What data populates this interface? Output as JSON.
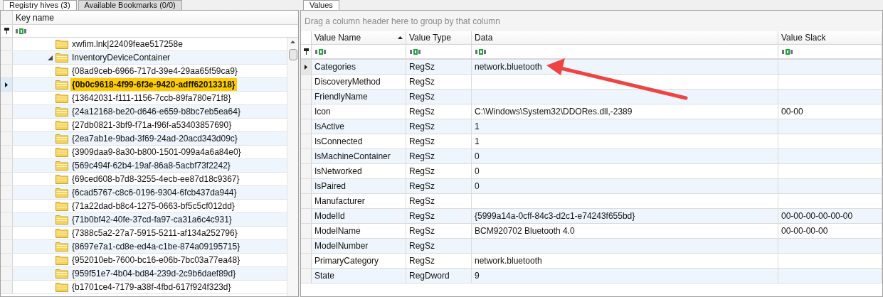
{
  "left_tabs": [
    {
      "label": "Registry hives (3)",
      "selected": true
    },
    {
      "label": "Available Bookmarks (0/0)",
      "selected": false
    }
  ],
  "tree": {
    "column": "Key name",
    "items": [
      {
        "children": [
          {
            "label": "xwfim.lnk|22409feae517258e",
            "selected": false
          }
        ]
      },
      {
        "label": "InventoryDeviceContainer",
        "expanded": true,
        "selected": false,
        "children": [
          {
            "label": "{08ad9ceb-6966-717d-39e4-29aa65f59ca9}",
            "selected": false
          },
          {
            "label": "{0b0c9618-4f99-6f3e-9420-adff62013318}",
            "selected": true
          },
          {
            "label": "{13642031-f111-1156-7ccb-89fa780e71f8}",
            "selected": false
          },
          {
            "label": "{24a12168-be20-d646-e659-b8bc7eb5ea64}",
            "selected": false
          },
          {
            "label": "{27db0821-3bf9-f71a-f96f-a53403857690}",
            "selected": false
          },
          {
            "label": "{2ea7ab1e-9bad-3f69-24ad-20acd343d09c}",
            "selected": false
          },
          {
            "label": "{3909daa9-8a30-b800-1501-099a4a6a84e0}",
            "selected": false
          },
          {
            "label": "{569c494f-62b4-19af-86a8-5acbf73f2242}",
            "selected": false
          },
          {
            "label": "{69ced608-b7d8-3255-4ecb-ee87d18c9367}",
            "selected": false
          },
          {
            "label": "{6cad5767-c8c6-0196-9304-6fcb437da944}",
            "selected": false
          },
          {
            "label": "{71a22dad-b8c4-1275-0663-bf5c5cf012dd}",
            "selected": false
          },
          {
            "label": "{71b0bf42-40fe-37cd-fa97-ca31a6c4c931}",
            "selected": false
          },
          {
            "label": "{7388c5a2-27a7-5915-5211-af134a252796}",
            "selected": false
          },
          {
            "label": "{8697e7a1-cd8e-ed4a-c1be-874a09195715}",
            "selected": false
          },
          {
            "label": "{952010eb-7600-bc16-e06b-7bc03a77ea48}",
            "selected": false
          },
          {
            "label": "{959f51e7-4b04-bd84-239d-2c9b6daef89d}",
            "selected": false
          },
          {
            "label": "{b1701ce4-7179-a38f-4fbd-617f924f323d}",
            "selected": false
          }
        ]
      }
    ]
  },
  "right_tabs": [
    {
      "label": "Values",
      "selected": true
    }
  ],
  "group_hint": "Drag a column header here to group by that column",
  "table": {
    "columns": [
      {
        "label": "Value Name",
        "sorted": true
      },
      {
        "label": "Value Type",
        "sorted": false
      },
      {
        "label": "Data",
        "sorted": false
      },
      {
        "label": "Value Slack",
        "sorted": false
      }
    ],
    "rows": [
      {
        "selected": true,
        "cells": [
          "Categories",
          "RegSz",
          "network.bluetooth",
          ""
        ]
      },
      {
        "selected": false,
        "cells": [
          "DiscoveryMethod",
          "RegSz",
          "",
          ""
        ]
      },
      {
        "selected": false,
        "cells": [
          "FriendlyName",
          "RegSz",
          "",
          ""
        ]
      },
      {
        "selected": false,
        "cells": [
          "Icon",
          "RegSz",
          "C:\\Windows\\System32\\DDORes.dll,-2389",
          "00-00"
        ]
      },
      {
        "selected": false,
        "cells": [
          "IsActive",
          "RegSz",
          "1",
          ""
        ]
      },
      {
        "selected": false,
        "cells": [
          "IsConnected",
          "RegSz",
          "1",
          ""
        ]
      },
      {
        "selected": false,
        "cells": [
          "IsMachineContainer",
          "RegSz",
          "0",
          ""
        ]
      },
      {
        "selected": false,
        "cells": [
          "IsNetworked",
          "RegSz",
          "0",
          ""
        ]
      },
      {
        "selected": false,
        "cells": [
          "IsPaired",
          "RegSz",
          "0",
          ""
        ]
      },
      {
        "selected": false,
        "cells": [
          "Manufacturer",
          "RegSz",
          "",
          ""
        ]
      },
      {
        "selected": false,
        "cells": [
          "ModelId",
          "RegSz",
          "{5999a14a-0cff-84c3-d2c1-e74243f655bd}",
          "00-00-00-00-00-00"
        ]
      },
      {
        "selected": false,
        "cells": [
          "ModelName",
          "RegSz",
          "BCM920702 Bluetooth 4.0",
          "00-00-00-00"
        ]
      },
      {
        "selected": false,
        "cells": [
          "ModelNumber",
          "RegSz",
          "",
          ""
        ]
      },
      {
        "selected": false,
        "cells": [
          "PrimaryCategory",
          "RegSz",
          "network.bluetooth",
          ""
        ]
      },
      {
        "selected": false,
        "cells": [
          "State",
          "RegDword",
          "9",
          ""
        ]
      }
    ]
  }
}
